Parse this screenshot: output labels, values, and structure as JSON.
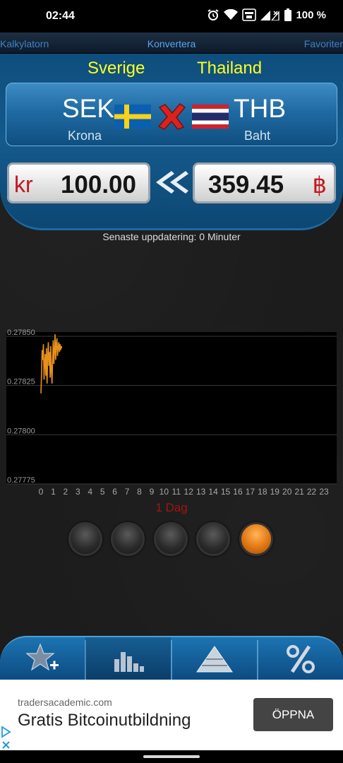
{
  "status": {
    "time": "02:44",
    "battery": "100 %",
    "icons": [
      "alarm-icon",
      "wifi-icon",
      "volte-icon",
      "signal-icon",
      "battery-icon"
    ]
  },
  "tabs": {
    "left": "Kalkylatorn",
    "center": "Konvertera",
    "right": "Favoriter"
  },
  "converter": {
    "from": {
      "country": "Sverige",
      "code": "SEK",
      "name": "Krona",
      "symbol": "kr",
      "amount": "100.00",
      "flag": "sweden-flag-icon"
    },
    "to": {
      "country": "Thailand",
      "code": "THB",
      "name": "Baht",
      "symbol": "฿",
      "amount": "359.45",
      "flag": "thailand-flag-icon"
    },
    "swap_icon": "swap-x-icon",
    "direction_icon": "double-chevron-left-icon",
    "last_update": "Senaste uppdatering: 0 Minuter"
  },
  "chart_caption": "1 Dag",
  "chart_data": {
    "type": "line",
    "title": "",
    "xlabel": "",
    "ylabel": "",
    "xlim": [
      0,
      23
    ],
    "ylim": [
      0.27775,
      0.2785
    ],
    "x_ticks": [
      "0",
      "1",
      "2",
      "3",
      "4",
      "5",
      "6",
      "7",
      "8",
      "9",
      "10",
      "11",
      "12",
      "13",
      "14",
      "15",
      "16",
      "17",
      "18",
      "19",
      "20",
      "21",
      "22",
      "23"
    ],
    "y_ticks": [
      "0.27850",
      "0.27825",
      "0.27800",
      "0.27775"
    ],
    "grid": true,
    "line_color": "#e8901c",
    "series": [
      {
        "x": [
          0.0,
          0.05,
          0.1,
          0.15,
          0.2,
          0.25,
          0.3,
          0.35,
          0.4,
          0.45,
          0.5,
          0.55,
          0.6,
          0.65,
          0.7,
          0.75,
          0.8,
          0.85,
          0.9,
          0.95,
          1.0,
          1.05,
          1.1,
          1.15,
          1.2,
          1.25,
          1.3,
          1.35,
          1.4,
          1.45,
          1.5,
          1.55,
          1.6,
          1.65,
          1.7
        ],
        "y": [
          0.27821,
          0.27831,
          0.27843,
          0.27838,
          0.27846,
          0.27828,
          0.27836,
          0.27841,
          0.2783,
          0.27844,
          0.27826,
          0.2784,
          0.27847,
          0.27835,
          0.27842,
          0.27829,
          0.27845,
          0.27833,
          0.27826,
          0.27838,
          0.27848,
          0.27836,
          0.27843,
          0.27851,
          0.27838,
          0.27846,
          0.27849,
          0.2784,
          0.27844,
          0.27847,
          0.27842,
          0.27846,
          0.27843,
          0.27845,
          0.27844
        ]
      }
    ]
  },
  "periods": [
    {
      "state": "off"
    },
    {
      "state": "off"
    },
    {
      "state": "off"
    },
    {
      "state": "off"
    },
    {
      "state": "on"
    }
  ],
  "toolbar": [
    "add-favorite-star-icon",
    "bar-chart-icon",
    "pyramid-icon",
    "percent-icon"
  ],
  "ad": {
    "domain": "tradersacademic.com",
    "title": "Gratis Bitcoinutbildning",
    "button": "ÖPPNA"
  }
}
